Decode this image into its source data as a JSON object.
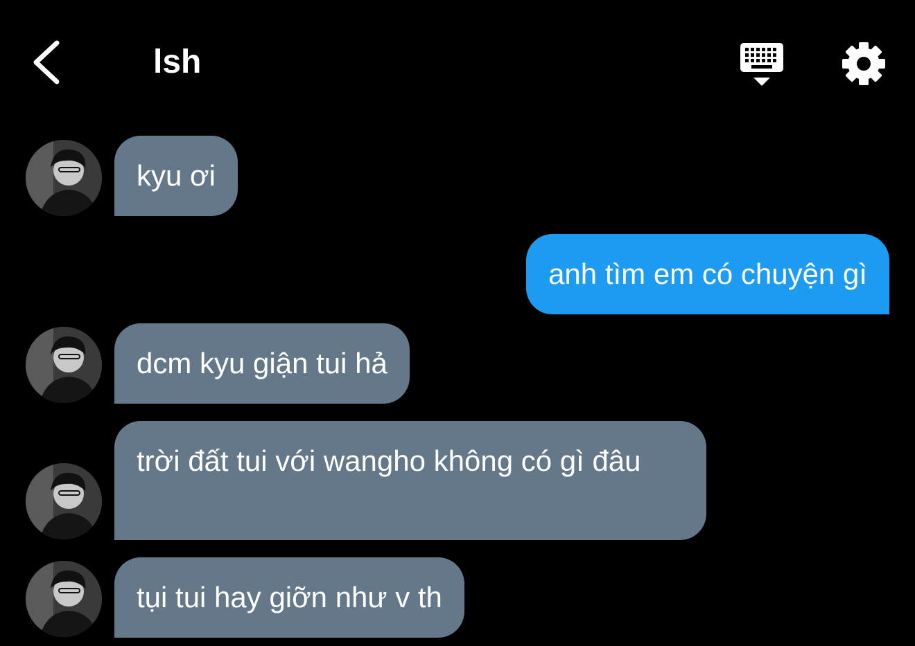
{
  "header": {
    "title": "lsh",
    "back_icon": "chevron-left-icon",
    "keyboard_icon": "keyboard-icon",
    "settings_icon": "gear-icon"
  },
  "colors": {
    "background": "#000000",
    "incoming_bubble": "#65788a",
    "outgoing_bubble": "#1d9bf0",
    "text": "#ffffff"
  },
  "messages": [
    {
      "direction": "incoming",
      "text": "kyu ơi"
    },
    {
      "direction": "outgoing",
      "text": "anh tìm em có chuyện gì"
    },
    {
      "direction": "incoming",
      "text": "dcm kyu giận tui hả"
    },
    {
      "direction": "incoming",
      "text": "trời đất tui với wangho không có gì đâu"
    },
    {
      "direction": "incoming",
      "text": "tụi tui hay giỡn như v th"
    }
  ]
}
